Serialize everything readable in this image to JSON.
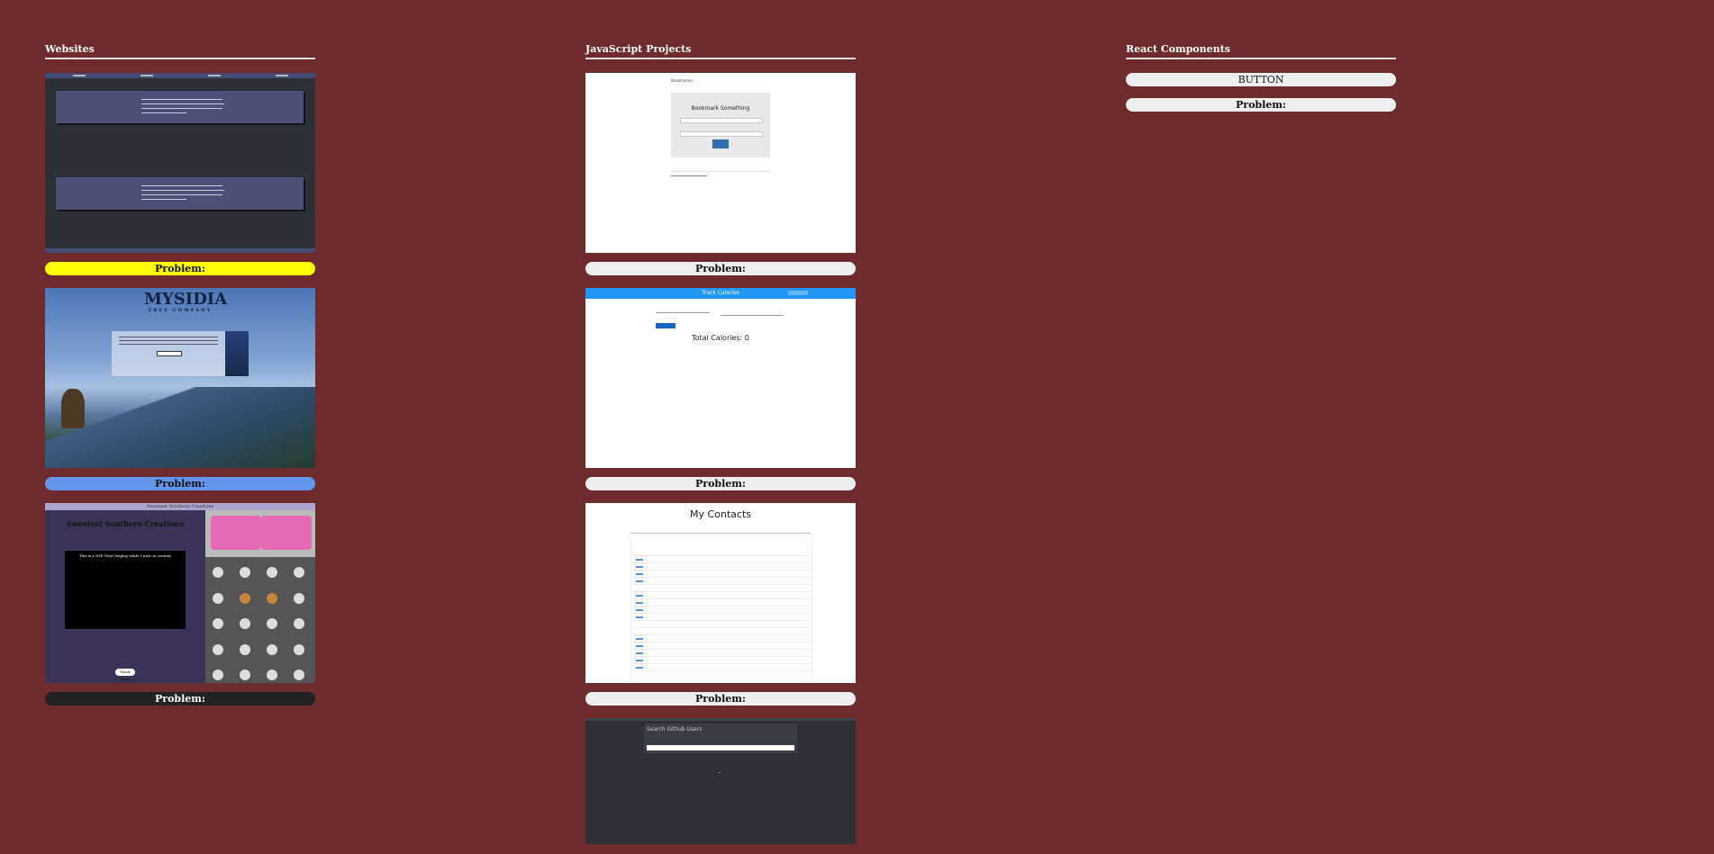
{
  "columns": {
    "websites": {
      "title": "Websites"
    },
    "javascript": {
      "title": "JavaScript Projects"
    },
    "react": {
      "title": "React Components"
    }
  },
  "websites": {
    "items": [
      {
        "problem_label": "Problem:",
        "button_color": "#ffff00"
      },
      {
        "problem_label": "Problem:",
        "button_color": "#6495ed",
        "logo_text": "MYSIDIA",
        "logo_sub": "FREE COMPANY"
      },
      {
        "problem_label": "Problem:",
        "button_color": "#222222",
        "header_text": "Sweetest Southern Creations",
        "title_text": "Sweetest Southern Creations",
        "video_text": "This is a WIP. First Display while I wait on content",
        "readmore_text": "Read More"
      }
    ]
  },
  "javascript": {
    "items": [
      {
        "problem_label": "Problem:",
        "header_text": "Bookmarker",
        "box_title": "Bookmark Something"
      },
      {
        "problem_label": "Problem:",
        "bar_title": "Track Calories",
        "total_text": "Total Calories: 0"
      },
      {
        "problem_label": "Problem:",
        "heading": "My Contacts"
      },
      {
        "panel_title": "Search Github Users"
      }
    ]
  },
  "react": {
    "button_label": "BUTTON",
    "problem_label": "Problem:"
  }
}
